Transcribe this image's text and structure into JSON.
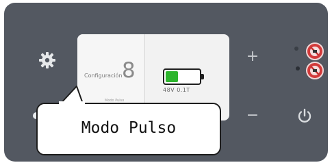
{
  "display": {
    "config_label": "Configuración",
    "config_value": "8",
    "mode_small": "Modo Pulso",
    "battery_fill": 0.38,
    "voltage": "48V 0.1T"
  },
  "controls": {
    "plus": "+",
    "minus": "−"
  },
  "callout": {
    "text": "Modo Pulso"
  },
  "colors": {
    "panel": "#535861",
    "battery": "#2db52d",
    "warning": "#d23a3a"
  },
  "icons": [
    "gear-icon",
    "power-icon",
    "warning-icon"
  ]
}
